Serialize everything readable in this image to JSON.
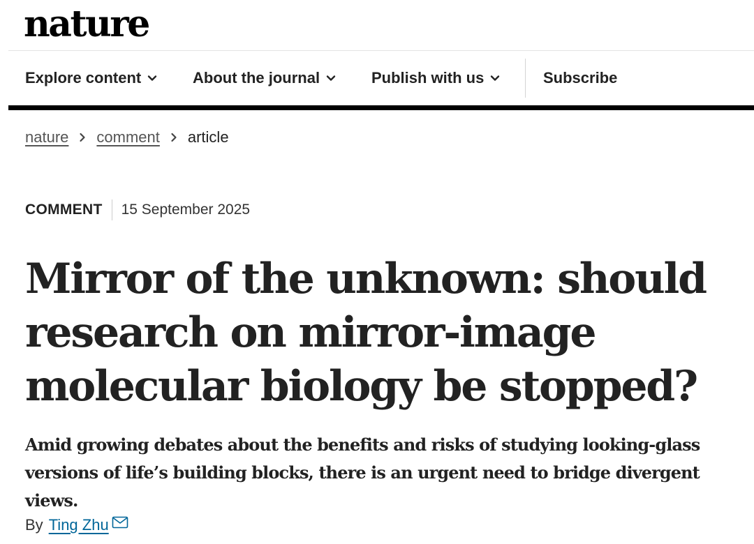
{
  "brand": {
    "logo_text": "nature"
  },
  "nav": {
    "items": [
      {
        "label": "Explore content",
        "icon": "chevron-down-icon"
      },
      {
        "label": "About the journal",
        "icon": "chevron-down-icon"
      },
      {
        "label": "Publish with us",
        "icon": "chevron-down-icon"
      }
    ],
    "subscribe_label": "Subscribe"
  },
  "breadcrumb": {
    "items": [
      {
        "label": "nature",
        "link": true
      },
      {
        "label": "comment",
        "link": true
      },
      {
        "label": "article",
        "link": false
      }
    ],
    "separator_icon": "chevron-right-icon"
  },
  "article": {
    "type": "COMMENT",
    "date": "15 September 2025",
    "title": "Mirror of the unknown: should research on mirror-image molecular biology be stopped?",
    "standfirst": "Amid growing debates about the benefits and risks of studying looking-glass versions of life’s building blocks, there is an urgent need to bridge divergent views.",
    "byline_prefix": "By",
    "author": "Ting Zhu",
    "author_icon": "mail-icon"
  },
  "colors": {
    "text": "#222222",
    "muted_link": "#555555",
    "author_link": "#006699",
    "nav_bar": "#000000"
  }
}
